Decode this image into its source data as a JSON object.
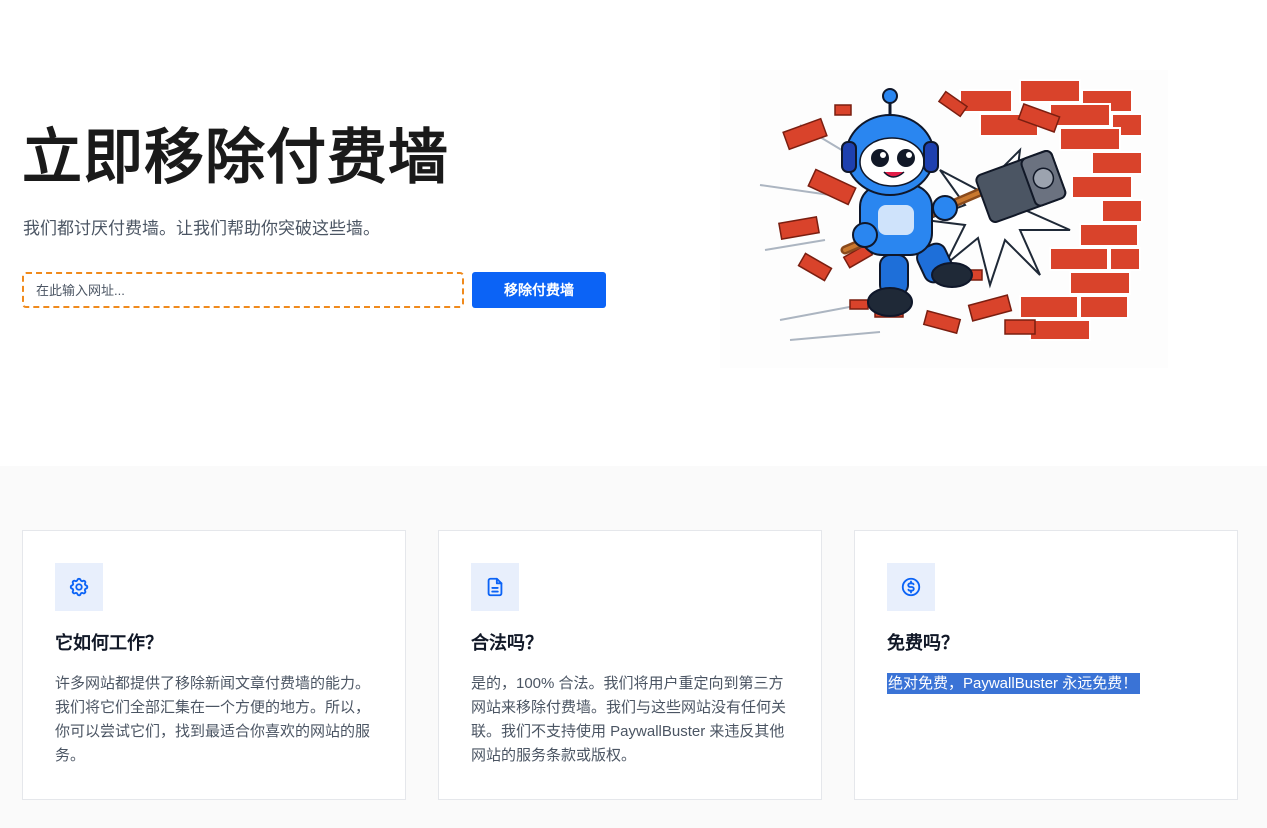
{
  "hero": {
    "title": "立即移除付费墙",
    "subtitle": "我们都讨厌付费墙。让我们帮助你突破这些墙。",
    "url_placeholder": "在此输入网址...",
    "submit_label": "移除付费墙",
    "illustration_icon": "robot-breaking-brick-wall-illustration"
  },
  "features": {
    "cards": [
      {
        "icon": "gear-icon",
        "title": "它如何工作？",
        "text": "许多网站都提供了移除新闻文章付费墙的能力。我们将它们全部汇集在一个方便的地方。所以，你可以尝试它们，找到最适合你喜欢的网站的服务。"
      },
      {
        "icon": "document-icon",
        "title": "合法吗？",
        "text": "是的，100% 合法。我们将用户重定向到第三方网站来移除付费墙。我们与这些网站没有任何关联。我们不支持使用 PaywallBuster 来违反其他网站的服务条款或版权。"
      },
      {
        "icon": "dollar-circle-icon",
        "title": "免费吗？",
        "text": "绝对免费，PaywallBuster 永远免费！"
      }
    ]
  },
  "colors": {
    "accent": "#0b63f6",
    "input_border": "#f08a1c",
    "icon_bg": "#e8effc",
    "selection_highlight": "#3a73d6"
  }
}
